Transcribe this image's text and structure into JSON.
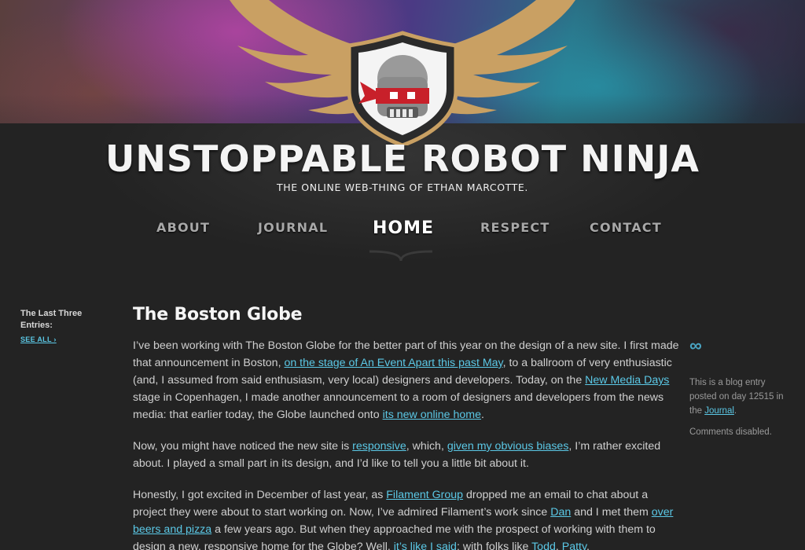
{
  "site": {
    "title": "UNSTOPPABLE ROBOT NINJA",
    "tagline": "THE ONLINE WEB-THING OF ETHAN MARCOTTE."
  },
  "nav": {
    "items": [
      {
        "label": "ABOUT"
      },
      {
        "label": "JOURNAL"
      },
      {
        "label": "HOME",
        "active": true
      },
      {
        "label": "RESPECT"
      },
      {
        "label": "CONTACT"
      }
    ]
  },
  "sidebar_left": {
    "heading": "The Last Three Entries:",
    "see_all": "SEE ALL ›"
  },
  "article": {
    "title": "The Boston Globe",
    "p1": {
      "t1": "I’ve been working with The Boston Globe for the better part of this year on the design of a new site. I first made that announcement in Boston, ",
      "l1": "on the stage of An Event Apart this past May",
      "t2": ", to a ballroom of very enthusiastic (and, I assumed from said enthusiasm, very local) designers and developers. Today, on the ",
      "l2": "New Media Days",
      "t3": " stage in Copenhagen, I made another announcement to a room of designers and developers from the news media: that earlier today, the Globe launched onto ",
      "l3": "its new online home",
      "t4": "."
    },
    "p2": {
      "t1": "Now, you might have noticed the new site is ",
      "l1": "responsive",
      "t2": ", which, ",
      "l2": "given my obvious biases",
      "t3": ", I’m rather excited about. I played a small part in its design, and I’d like to tell you a little bit about it."
    },
    "p3": {
      "t1": "Honestly, I got excited in December of last year, as ",
      "l1": "Filament Group",
      "t2": " dropped me an email to chat about a project they were about to start working on. Now, I’ve admired Filament’s work since ",
      "l2": "Dan",
      "t3": " and I met them ",
      "l3": "over beers and pizza",
      "t4": " a few years ago. But when they approached me with the prospect of working with them to design a new, responsive home for the Globe? Well, ",
      "l4": "it’s like I said",
      "t5": ": with folks like ",
      "l5": "Todd",
      "t6": ", ",
      "l6": "Patty",
      "t7": ","
    }
  },
  "sidebar_right": {
    "permalink_glyph": "∞",
    "meta_text": "This is a blog entry posted on day 12515 in the ",
    "meta_link": "Journal",
    "meta_end": ".",
    "comments": "Comments disabled."
  },
  "colors": {
    "background": "#232323",
    "link": "#5bc8e6",
    "wing_gold": "#c9a063",
    "mask_red": "#c8202a"
  },
  "icons": [
    "robot-ninja-logo",
    "infinity-permalink-icon"
  ]
}
